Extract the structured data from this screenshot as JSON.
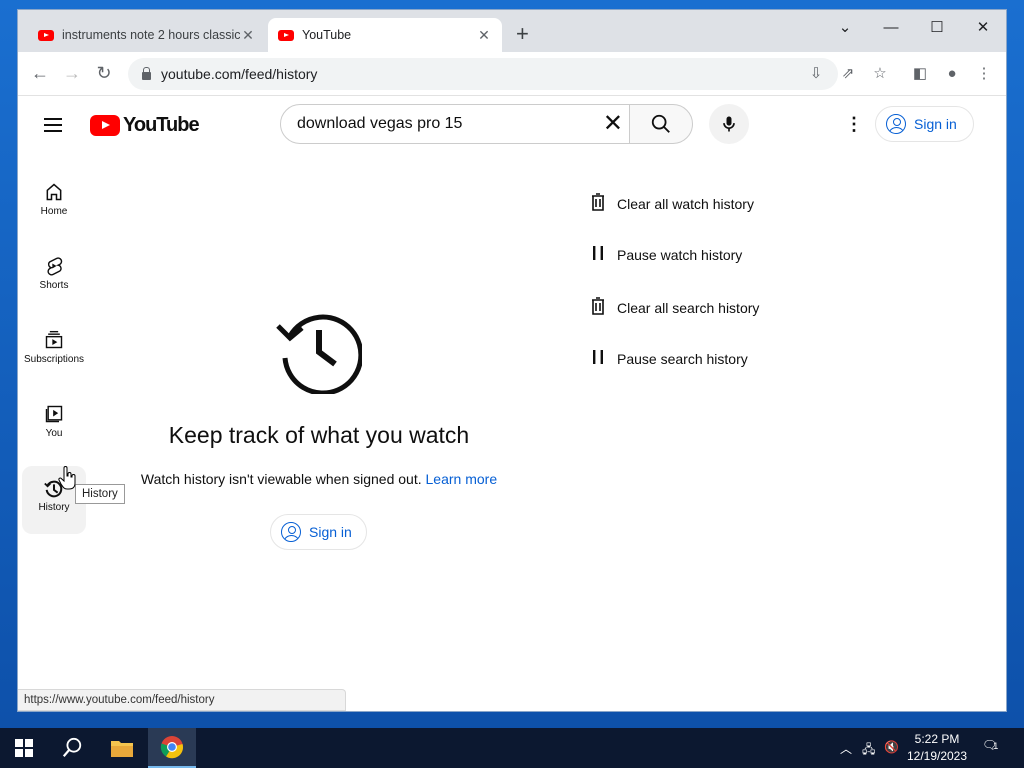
{
  "tabs": [
    {
      "label": "instruments note 2 hours classic"
    },
    {
      "label": "YouTube"
    }
  ],
  "address": {
    "url": "youtube.com/feed/history"
  },
  "header": {
    "logo": "YouTube",
    "search_value": "download vegas pro 15",
    "sign_in": "Sign in"
  },
  "sidebar": {
    "items": [
      {
        "label": "Home",
        "icon": "home-icon"
      },
      {
        "label": "Shorts",
        "icon": "shorts-icon"
      },
      {
        "label": "Subscriptions",
        "icon": "subscriptions-icon"
      },
      {
        "label": "You",
        "icon": "you-icon"
      },
      {
        "label": "History",
        "icon": "history-icon"
      }
    ],
    "tooltip": "History"
  },
  "main": {
    "title": "Keep track of what you watch",
    "subtitle": "Watch history isn't viewable when signed out.",
    "learn_more": "Learn more",
    "sign_in": "Sign in"
  },
  "actions": [
    {
      "label": "Clear all watch history",
      "icon": "trash-icon"
    },
    {
      "label": "Pause watch history",
      "icon": "pause-icon"
    },
    {
      "label": "Clear all search history",
      "icon": "trash-icon"
    },
    {
      "label": "Pause search history",
      "icon": "pause-icon"
    }
  ],
  "status_url": "https://www.youtube.com/feed/history",
  "taskbar": {
    "time": "5:22 PM",
    "date": "12/19/2023",
    "notifications": "1"
  },
  "colors": {
    "accent": "#065fd4",
    "brand": "#ff0000"
  }
}
